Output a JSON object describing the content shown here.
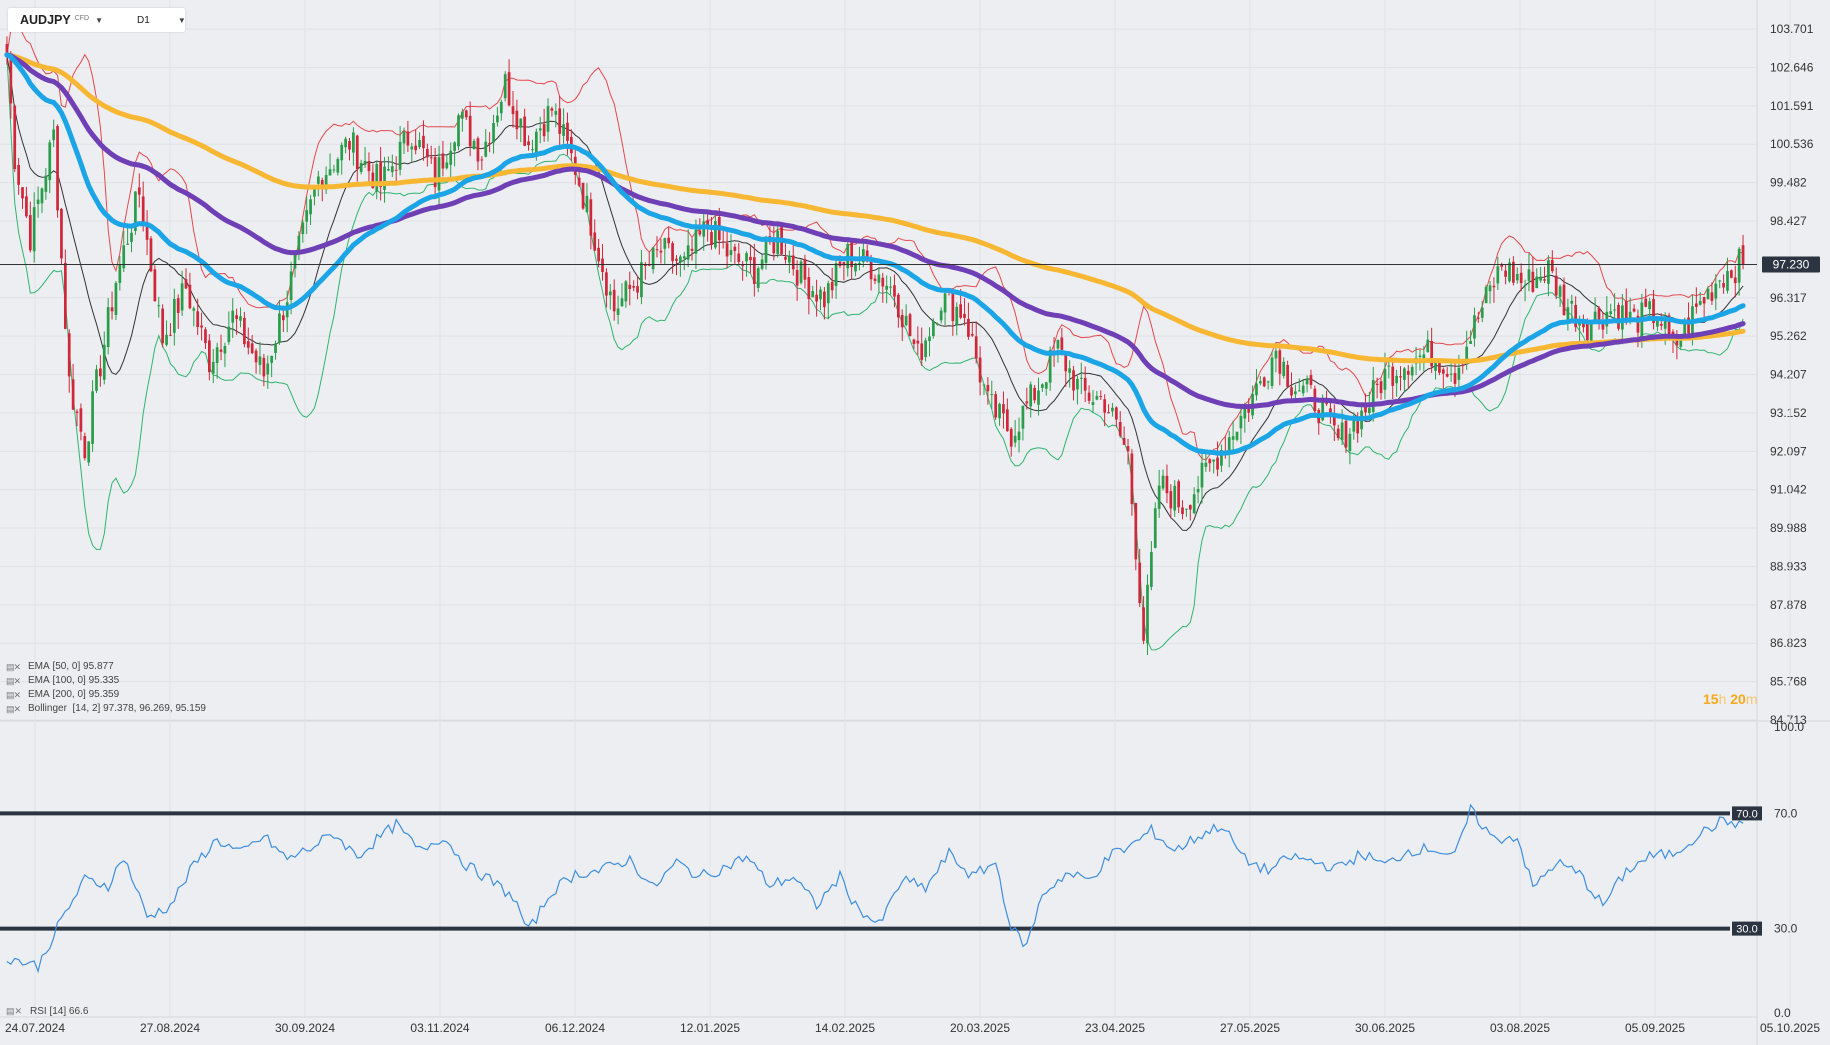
{
  "symbol": "AUDJPY",
  "symbol_tag": "CFD",
  "timeframe": "D1",
  "price_axis": {
    "labels": [
      "103.701",
      "102.646",
      "101.591",
      "100.536",
      "99.482",
      "98.427",
      "96.317",
      "95.262",
      "94.207",
      "93.152",
      "92.097",
      "91.042",
      "89.988",
      "88.933",
      "87.878",
      "86.823",
      "85.768",
      "84.713"
    ],
    "current_price": "97.230",
    "current_value": 97.23
  },
  "time_axis": {
    "labels": [
      "24.07.2024",
      "27.08.2024",
      "30.09.2024",
      "03.11.2024",
      "06.12.2024",
      "12.01.2025",
      "14.02.2025",
      "20.03.2025",
      "23.04.2025",
      "27.05.2025",
      "30.06.2025",
      "03.08.2025",
      "05.09.2025",
      "05.10.2025"
    ]
  },
  "indicators": [
    {
      "id": "ema50",
      "label": "EMA",
      "params": "[50, 0]",
      "value": "95.877",
      "color": "#1ba5e6"
    },
    {
      "id": "ema100",
      "label": "EMA",
      "params": "[100, 0]",
      "value": "95.335",
      "color": "#6f3fb6"
    },
    {
      "id": "ema200",
      "label": "EMA",
      "params": "[200, 0]",
      "value": "95.359",
      "color": "#f7b733"
    },
    {
      "id": "boll",
      "label": "Bollinger",
      "params": "[14, 2]",
      "value": "97.378,  96.269,  95.159",
      "color": "#e5484d"
    }
  ],
  "rsi": {
    "label": "RSI",
    "params": "[14]",
    "value": "66.6",
    "axis_labels": [
      "100.0",
      "70.0",
      "30.0",
      "0.0"
    ],
    "levels": [
      70,
      30
    ]
  },
  "timer": {
    "hours": "15",
    "h": "h",
    "minutes": "20",
    "m": "m"
  },
  "colors": {
    "bull": "#2a9d4a",
    "bear": "#d0283a",
    "ema50": "#1ba5e6",
    "ema100": "#6f3fb6",
    "ema200": "#f7b733",
    "boll_upper": "#e5484d",
    "boll_mid": "#333333",
    "boll_lower": "#2fb56d",
    "rsi": "#3d8ee0"
  },
  "chart_data": {
    "type": "candlestick",
    "ylim": [
      84.713,
      104.5
    ],
    "rsi_ylim": [
      0,
      100
    ],
    "price_anchors": [
      [
        0,
        103.0
      ],
      [
        2,
        100.2
      ],
      [
        6,
        98.0
      ],
      [
        12,
        100.8
      ],
      [
        16,
        94.0
      ],
      [
        20,
        92.2
      ],
      [
        28,
        96.8
      ],
      [
        34,
        99.2
      ],
      [
        40,
        95.2
      ],
      [
        46,
        96.6
      ],
      [
        52,
        94.6
      ],
      [
        58,
        95.8
      ],
      [
        66,
        94.2
      ],
      [
        72,
        96.4
      ],
      [
        80,
        99.6
      ],
      [
        88,
        100.6
      ],
      [
        96,
        99.4
      ],
      [
        104,
        100.9
      ],
      [
        110,
        99.6
      ],
      [
        116,
        101.3
      ],
      [
        122,
        100.3
      ],
      [
        128,
        102.2
      ],
      [
        134,
        100.6
      ],
      [
        140,
        101.5
      ],
      [
        146,
        99.9
      ],
      [
        150,
        98.4
      ],
      [
        156,
        96.0
      ],
      [
        162,
        96.8
      ],
      [
        168,
        97.6
      ],
      [
        174,
        97.2
      ],
      [
        180,
        98.3
      ],
      [
        186,
        97.4
      ],
      [
        192,
        97.1
      ],
      [
        198,
        98.0
      ],
      [
        204,
        96.9
      ],
      [
        210,
        96.3
      ],
      [
        216,
        97.5
      ],
      [
        222,
        97.2
      ],
      [
        228,
        96.5
      ],
      [
        234,
        94.7
      ],
      [
        240,
        96.3
      ],
      [
        246,
        95.9
      ],
      [
        252,
        93.4
      ],
      [
        258,
        92.6
      ],
      [
        264,
        93.7
      ],
      [
        270,
        94.9
      ],
      [
        276,
        93.7
      ],
      [
        282,
        93.5
      ],
      [
        288,
        92.0
      ],
      [
        292,
        87.0
      ],
      [
        296,
        91.2
      ],
      [
        302,
        90.6
      ],
      [
        308,
        91.5
      ],
      [
        314,
        92.5
      ],
      [
        320,
        93.6
      ],
      [
        326,
        94.9
      ],
      [
        330,
        94.0
      ],
      [
        336,
        93.5
      ],
      [
        342,
        92.4
      ],
      [
        348,
        93.1
      ],
      [
        354,
        94.2
      ],
      [
        360,
        94.6
      ],
      [
        366,
        94.8
      ],
      [
        372,
        94.3
      ],
      [
        378,
        95.8
      ],
      [
        384,
        97.2
      ],
      [
        390,
        96.7
      ],
      [
        396,
        97.1
      ],
      [
        400,
        96.2
      ],
      [
        406,
        95.6
      ],
      [
        412,
        96.0
      ],
      [
        418,
        95.7
      ],
      [
        424,
        95.9
      ],
      [
        428,
        94.9
      ],
      [
        434,
        96.0
      ],
      [
        440,
        96.9
      ],
      [
        446,
        97.3
      ]
    ],
    "rsi_anchors": [
      [
        0,
        20
      ],
      [
        8,
        17
      ],
      [
        14,
        33
      ],
      [
        20,
        47
      ],
      [
        26,
        45
      ],
      [
        30,
        55
      ],
      [
        36,
        34
      ],
      [
        42,
        38
      ],
      [
        48,
        52
      ],
      [
        54,
        61
      ],
      [
        60,
        56
      ],
      [
        66,
        62
      ],
      [
        72,
        54
      ],
      [
        78,
        58
      ],
      [
        84,
        63
      ],
      [
        90,
        55
      ],
      [
        96,
        62
      ],
      [
        100,
        66
      ],
      [
        106,
        57
      ],
      [
        112,
        62
      ],
      [
        118,
        52
      ],
      [
        124,
        47
      ],
      [
        130,
        41
      ],
      [
        134,
        29
      ],
      [
        140,
        43
      ],
      [
        146,
        49
      ],
      [
        152,
        50
      ],
      [
        160,
        54
      ],
      [
        166,
        44
      ],
      [
        172,
        53
      ],
      [
        178,
        48
      ],
      [
        184,
        51
      ],
      [
        190,
        55
      ],
      [
        196,
        45
      ],
      [
        202,
        48
      ],
      [
        208,
        38
      ],
      [
        214,
        48
      ],
      [
        218,
        38
      ],
      [
        224,
        31
      ],
      [
        230,
        47
      ],
      [
        236,
        44
      ],
      [
        242,
        56
      ],
      [
        248,
        48
      ],
      [
        254,
        53
      ],
      [
        258,
        30
      ],
      [
        262,
        24
      ],
      [
        266,
        42
      ],
      [
        272,
        49
      ],
      [
        278,
        47
      ],
      [
        284,
        56
      ],
      [
        288,
        58
      ],
      [
        294,
        64
      ],
      [
        300,
        57
      ],
      [
        306,
        62
      ],
      [
        312,
        66
      ],
      [
        318,
        54
      ],
      [
        324,
        50
      ],
      [
        330,
        55
      ],
      [
        336,
        53
      ],
      [
        342,
        51
      ],
      [
        348,
        56
      ],
      [
        354,
        52
      ],
      [
        360,
        57
      ],
      [
        366,
        58
      ],
      [
        372,
        55
      ],
      [
        376,
        71
      ],
      [
        382,
        61
      ],
      [
        388,
        62
      ],
      [
        392,
        44
      ],
      [
        398,
        53
      ],
      [
        404,
        49
      ],
      [
        410,
        38
      ],
      [
        416,
        50
      ],
      [
        422,
        55
      ],
      [
        428,
        56
      ],
      [
        434,
        62
      ],
      [
        440,
        67
      ],
      [
        446,
        66.6
      ]
    ]
  }
}
